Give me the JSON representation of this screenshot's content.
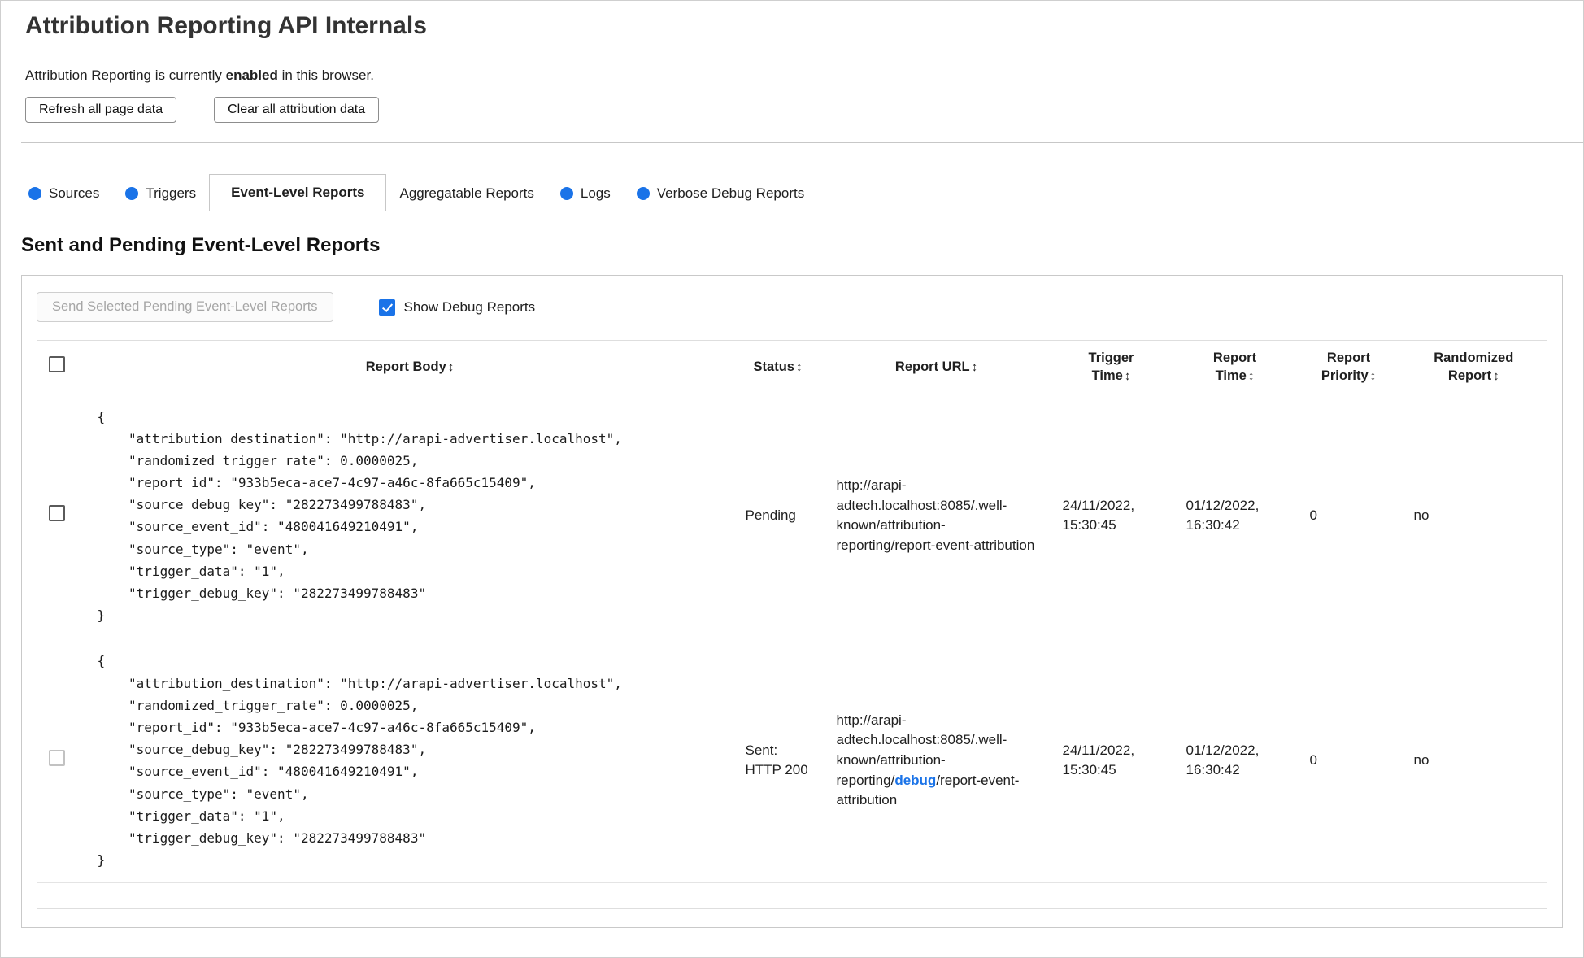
{
  "page": {
    "title": "Attribution Reporting API Internals",
    "status": {
      "prefix": "Attribution Reporting is currently ",
      "emphasis": "enabled",
      "suffix": " in this browser."
    },
    "buttons": {
      "refresh": "Refresh all page data",
      "clear": "Clear all attribution data"
    }
  },
  "colors": {
    "accent_blue": "#1a73e8"
  },
  "tabs": [
    {
      "label": "Sources",
      "has_dot": true,
      "active": false
    },
    {
      "label": "Triggers",
      "has_dot": true,
      "active": false
    },
    {
      "label": "Event-Level Reports",
      "has_dot": false,
      "active": true
    },
    {
      "label": "Aggregatable Reports",
      "has_dot": false,
      "active": false
    },
    {
      "label": "Logs",
      "has_dot": true,
      "active": false
    },
    {
      "label": "Verbose Debug Reports",
      "has_dot": true,
      "active": false
    }
  ],
  "section": {
    "heading": "Sent and Pending Event-Level Reports",
    "send_button_label": "Send Selected Pending Event-Level Reports",
    "send_button_enabled": false,
    "show_debug_label": "Show Debug Reports",
    "show_debug_checked": true
  },
  "table": {
    "sort_glyph": "↕",
    "headers": [
      "Report Body",
      "Status",
      "Report URL",
      "Trigger Time",
      "Report Time",
      "Report Priority",
      "Randomized Report"
    ],
    "rows": [
      {
        "selected": false,
        "selectable": true,
        "body": "{\n    \"attribution_destination\": \"http://arapi-advertiser.localhost\",\n    \"randomized_trigger_rate\": 0.0000025,\n    \"report_id\": \"933b5eca-ace7-4c97-a46c-8fa665c15409\",\n    \"source_debug_key\": \"282273499788483\",\n    \"source_event_id\": \"480041649210491\",\n    \"source_type\": \"event\",\n    \"trigger_data\": \"1\",\n    \"trigger_debug_key\": \"282273499788483\"\n}",
        "status": "Pending",
        "url": "http://arapi-adtech.localhost:8085/.well-known/attribution-reporting/report-event-attribution",
        "trigger_time": "24/11/2022, 15:30:45",
        "report_time": "01/12/2022, 16:30:42",
        "report_priority": "0",
        "randomized_report": "no"
      },
      {
        "selected": false,
        "selectable": false,
        "body": "{\n    \"attribution_destination\": \"http://arapi-advertiser.localhost\",\n    \"randomized_trigger_rate\": 0.0000025,\n    \"report_id\": \"933b5eca-ace7-4c97-a46c-8fa665c15409\",\n    \"source_debug_key\": \"282273499788483\",\n    \"source_event_id\": \"480041649210491\",\n    \"source_type\": \"event\",\n    \"trigger_data\": \"1\",\n    \"trigger_debug_key\": \"282273499788483\"\n}",
        "status": "Sent: HTTP 200",
        "url_prefix": "http://arapi-adtech.localhost:8085/.well-known/attribution-reporting/",
        "url_debug": "debug",
        "url_suffix": "/report-event-attribution",
        "trigger_time": "24/11/2022, 15:30:45",
        "report_time": "01/12/2022, 16:30:42",
        "report_priority": "0",
        "randomized_report": "no"
      }
    ]
  }
}
